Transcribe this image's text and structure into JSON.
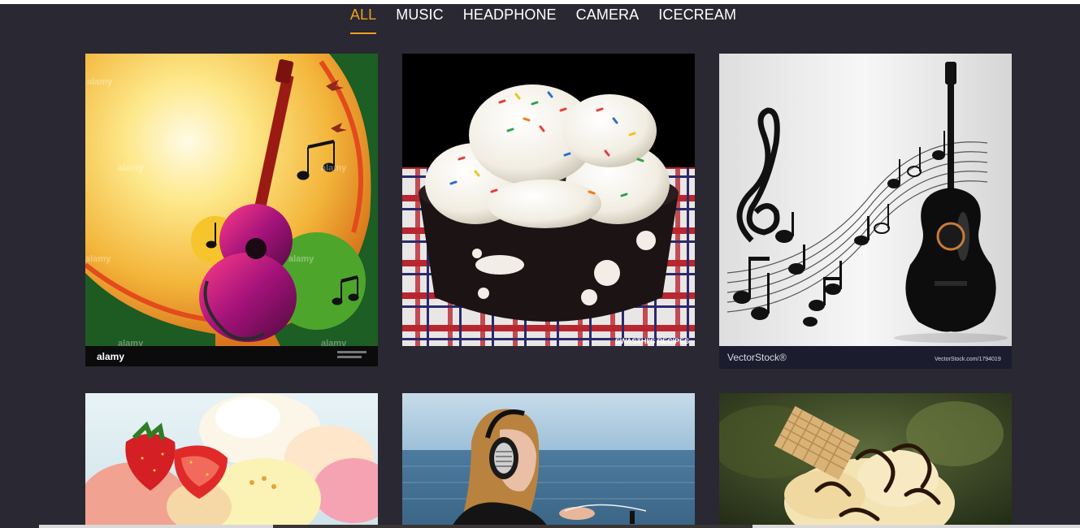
{
  "filters": [
    {
      "label": "ALL",
      "active": true
    },
    {
      "label": "MUSIC",
      "active": false
    },
    {
      "label": "HEADPHONE",
      "active": false
    },
    {
      "label": "CAMERA",
      "active": false
    },
    {
      "label": "ICECREAM",
      "active": false
    }
  ],
  "gallery": {
    "items": [
      {
        "category": "MUSIC",
        "subject": "colorful-guitar-art",
        "watermark_brand": "alamy"
      },
      {
        "category": "ICECREAM",
        "subject": "ice-cream-bowl-sprinkles",
        "watermark_brand": "SWASTHI'S RECIPES"
      },
      {
        "category": "MUSIC",
        "subject": "guitar-music-notes",
        "watermark_brand": "VectorStock®",
        "watermark_url": "VectorStock.com/1794019"
      },
      {
        "category": "ICECREAM",
        "subject": "ice-cream-scoops-strawberries"
      },
      {
        "category": "HEADPHONE",
        "subject": "woman-with-headphones-sea"
      },
      {
        "category": "ICECREAM",
        "subject": "ice-cream-sundae-wafer"
      }
    ]
  },
  "colors": {
    "background": "#2a2832",
    "active_filter": "#f0a023",
    "filter_text": "#ffffff"
  }
}
